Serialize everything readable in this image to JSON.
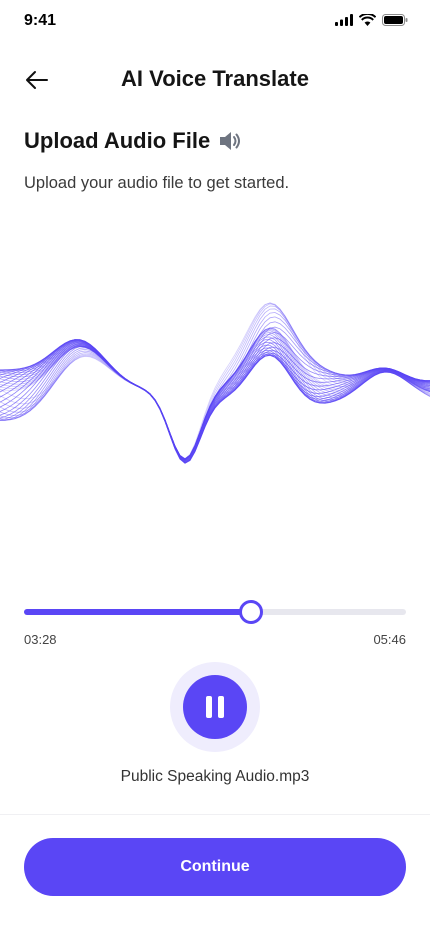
{
  "status_bar": {
    "time": "9:41",
    "icons": [
      "signal-icon",
      "wifi-icon",
      "battery-icon"
    ]
  },
  "header": {
    "title": "AI Voice Translate",
    "back_icon": "arrow-left-icon"
  },
  "section": {
    "title": "Upload Audio File",
    "title_icon": "speaker-icon",
    "subtitle": "Upload your audio file to get started."
  },
  "player": {
    "current_time": "03:28",
    "total_time": "05:46",
    "progress": 0.595,
    "state_icon": "pause-icon",
    "file_name": "Public Speaking Audio.mp3"
  },
  "actions": {
    "continue_label": "Continue"
  },
  "colors": {
    "accent": "#5a46f5",
    "accent_light": "#efedfd",
    "track": "#e7e7ee"
  }
}
